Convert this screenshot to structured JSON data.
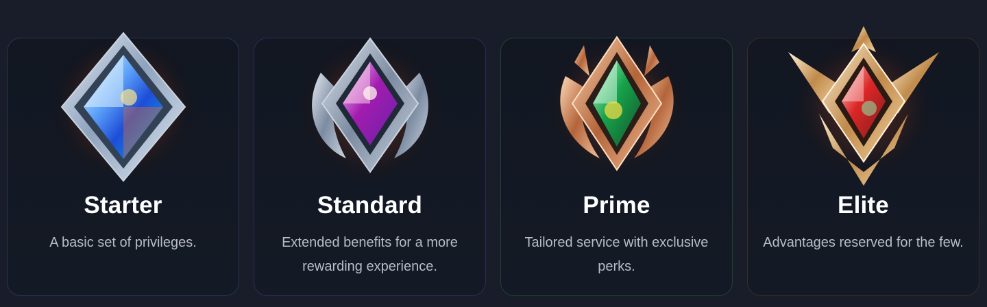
{
  "tiers": [
    {
      "name": "Starter",
      "description": "A basic set of privileges.",
      "badge_icon": "blue-crystal-diamond-badge-icon",
      "accent": "#3b82f6"
    },
    {
      "name": "Standard",
      "description": "Extended benefits for a more rewarding experience.",
      "badge_icon": "purple-crystal-winged-badge-icon",
      "accent": "#a855f7"
    },
    {
      "name": "Prime",
      "description": "Tailored service with exclusive perks.",
      "badge_icon": "green-crystal-laurel-badge-icon",
      "accent": "#22c55e"
    },
    {
      "name": "Elite",
      "description": "Advantages reserved for the few.",
      "badge_icon": "red-crystal-crown-badge-icon",
      "accent": "#ef4444"
    }
  ]
}
